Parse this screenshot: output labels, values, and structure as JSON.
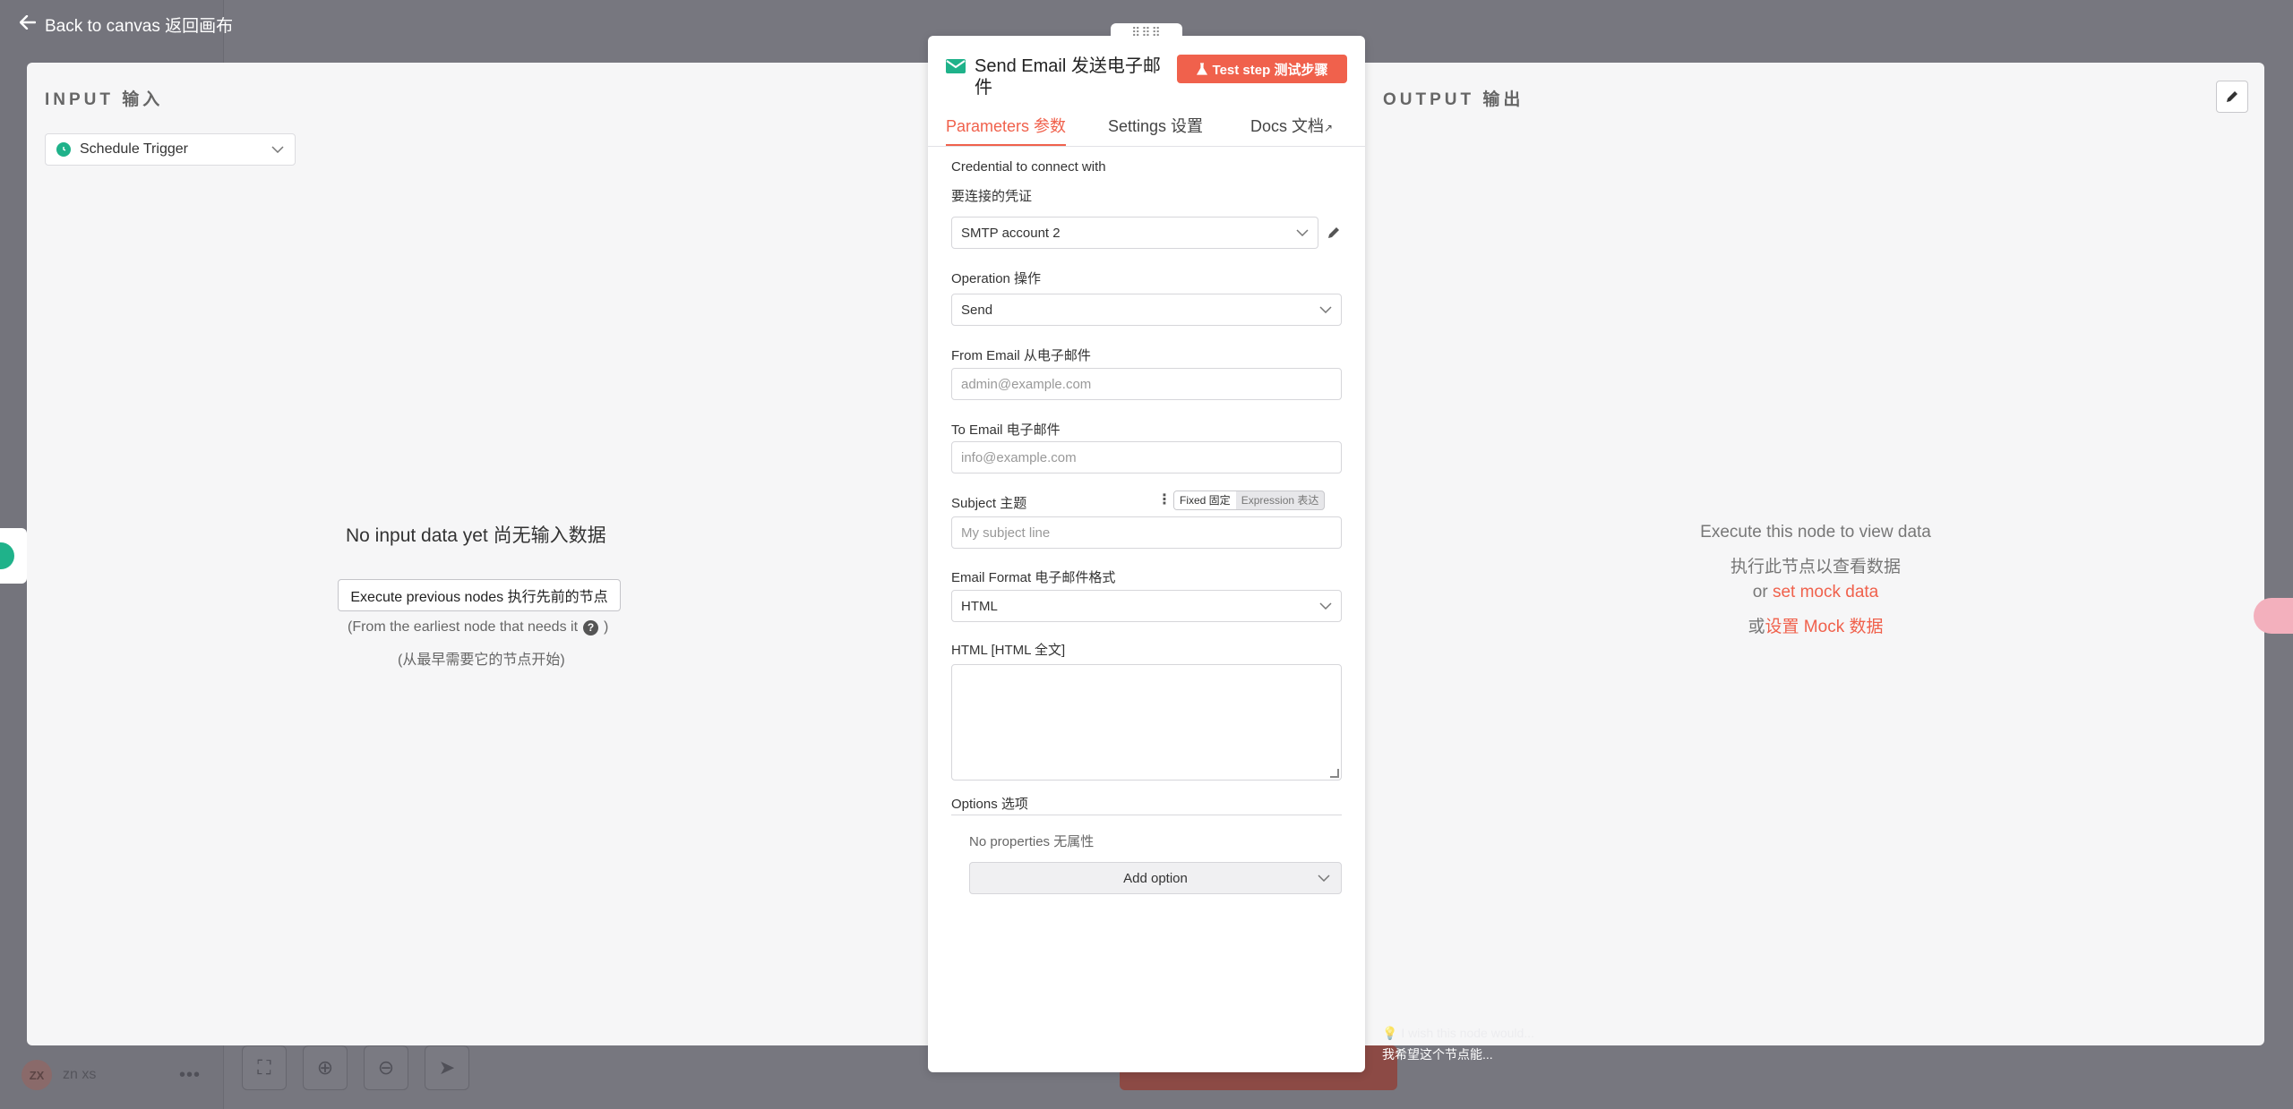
{
  "background": {
    "user_initials": "ZX",
    "user_name": "zn xs",
    "more_label": "•••"
  },
  "nav": {
    "back_label": "Back to canvas  返回画布"
  },
  "input_pane": {
    "title": "INPUT  输入",
    "trigger_select_value": "Schedule Trigger",
    "empty_text": "No input data yet  尚无输入数据",
    "execute_button": "Execute previous nodes  执行先前的节点",
    "hint_en": "(From the earliest node that needs it",
    "hint_en_close": ")",
    "hint_zh": "(从最早需要它的节点开始)"
  },
  "output_pane": {
    "title": "OUTPUT  输出",
    "line1": "Execute this node to view data",
    "line2": "执行此节点以查看数据",
    "line3_prefix": "or ",
    "line3_link": "set mock data",
    "line4_prefix": "或",
    "line4_link": "设置 Mock 数据"
  },
  "node": {
    "drag_handle": "⠿⠿⠿",
    "title": "Send Email  发送电子邮件",
    "test_button": "Test step  测试步骤",
    "tabs": [
      {
        "label": "Parameters  参数"
      },
      {
        "label": "Settings  设置"
      },
      {
        "label": "Docs  文档"
      }
    ],
    "credential": {
      "label_en": "Credential to connect with",
      "label_zh": "要连接的凭证",
      "value": "SMTP account 2"
    },
    "operation": {
      "label": "Operation  操作",
      "value": "Send"
    },
    "from_email": {
      "label": "From Email  从电子邮件",
      "placeholder": "admin@example.com"
    },
    "to_email": {
      "label": "To Email  电子邮件",
      "placeholder": "info@example.com"
    },
    "subject": {
      "label": "Subject  主题",
      "placeholder": "My subject line",
      "toggle_fixed": "Fixed  固定",
      "toggle_expression": "Expression  表达"
    },
    "email_format": {
      "label": "Email Format  电子邮件格式",
      "value": "HTML"
    },
    "html": {
      "label": "HTML  [HTML 全文]"
    },
    "options": {
      "label": "Options  选项",
      "empty": "No properties  无属性",
      "add_button": "Add option"
    }
  },
  "wish": {
    "line1": "I wish this node would...",
    "line2": "我希望这个节点能..."
  },
  "colors": {
    "accent": "#f0614c",
    "trigger_green": "#1fb28a"
  }
}
